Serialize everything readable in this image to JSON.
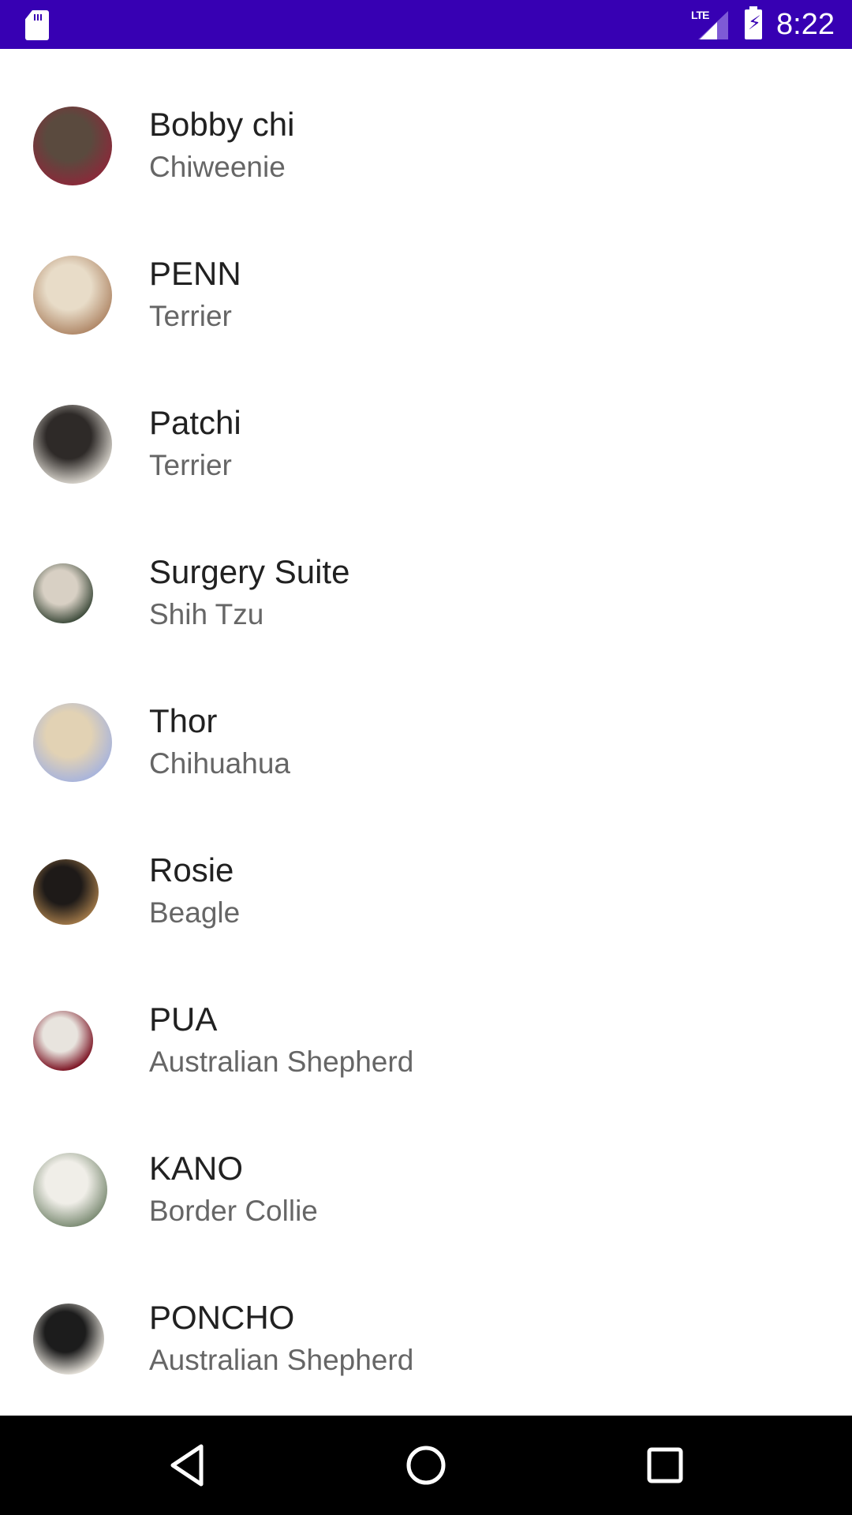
{
  "status_bar": {
    "time": "8:22",
    "network": "LTE",
    "icons": [
      "sd-card-icon",
      "lte-signal-icon",
      "battery-charging-icon"
    ],
    "background": "#3700b3"
  },
  "dogs": [
    {
      "name": "Bobby chi",
      "breed": "Chiweenie",
      "avatar_colors": [
        "#5a4a3e",
        "#8a2a3a"
      ]
    },
    {
      "name": "PENN",
      "breed": "Terrier",
      "avatar_colors": [
        "#e8dcc8",
        "#b08868"
      ]
    },
    {
      "name": "Patchi",
      "breed": "Terrier",
      "avatar_colors": [
        "#2e2a28",
        "#d8d4cc"
      ]
    },
    {
      "name": "Surgery Suite",
      "breed": "Shih Tzu",
      "avatar_colors": [
        "#d8d0c4",
        "#3c4a3a"
      ]
    },
    {
      "name": "Thor",
      "breed": "Chihuahua",
      "avatar_colors": [
        "#e2d2b4",
        "#a8b4dc"
      ]
    },
    {
      "name": "Rosie",
      "breed": "Beagle",
      "avatar_colors": [
        "#1e1a18",
        "#a07848"
      ]
    },
    {
      "name": "PUA",
      "breed": "Australian Shepherd",
      "avatar_colors": [
        "#e8e4de",
        "#7a1020"
      ]
    },
    {
      "name": "KANO",
      "breed": "Border Collie",
      "avatar_colors": [
        "#f0eee8",
        "#7c8c74"
      ]
    },
    {
      "name": "PONCHO",
      "breed": "Australian Shepherd",
      "avatar_colors": [
        "#1c1c1c",
        "#e8e4dc"
      ]
    }
  ],
  "nav_bar": {
    "buttons": [
      "back",
      "home",
      "recents"
    ]
  }
}
